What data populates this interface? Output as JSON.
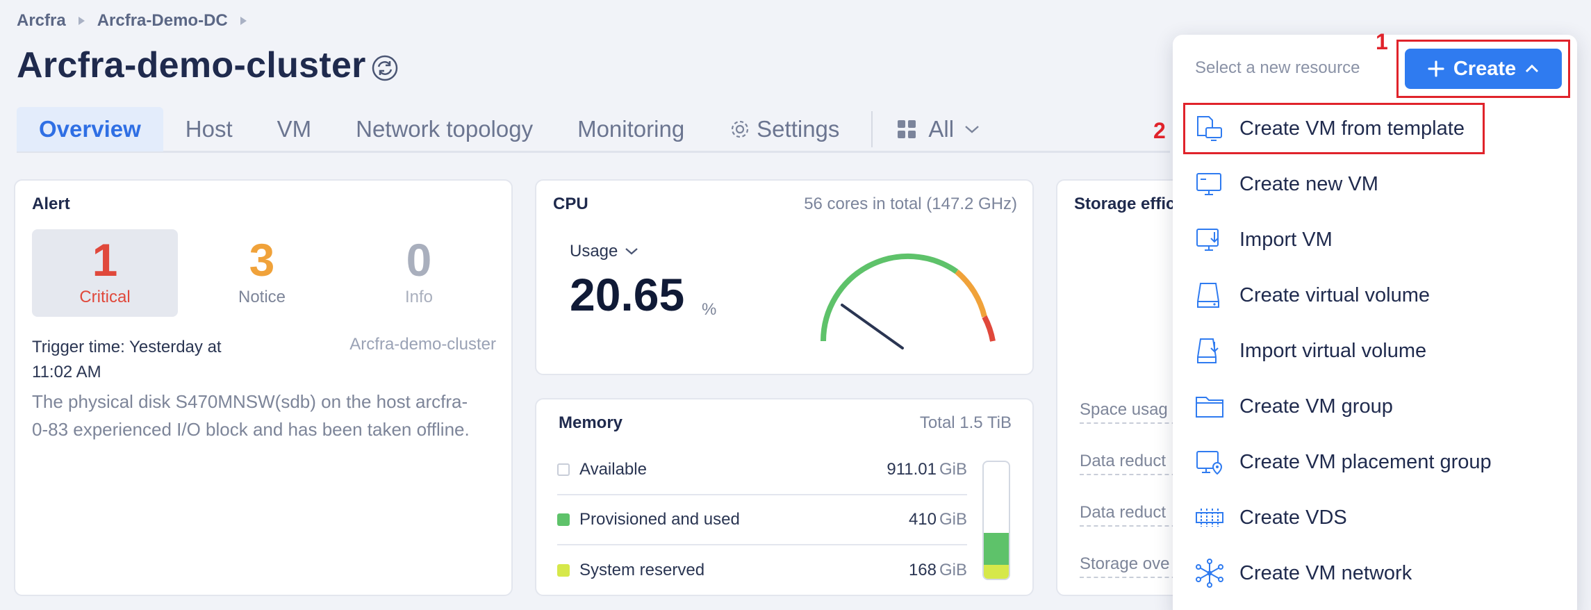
{
  "breadcrumb": [
    "Arcfra",
    "Arcfra-Demo-DC"
  ],
  "page_title": "Arcfra-demo-cluster",
  "tabs": {
    "overview": "Overview",
    "host": "Host",
    "vm": "VM",
    "network_topology": "Network topology",
    "monitoring": "Monitoring",
    "settings": "Settings",
    "all": "All"
  },
  "alert": {
    "title": "Alert",
    "critical": {
      "count": "1",
      "label": "Critical",
      "color": "#e0483b"
    },
    "notice": {
      "count": "3",
      "label": "Notice",
      "color": "#f0a23a"
    },
    "info": {
      "count": "0",
      "label": "Info",
      "color": "#a9afbd"
    },
    "trigger_time": "Trigger time: Yesterday at 11:02 AM",
    "cluster": "Arcfra-demo-cluster",
    "description": "The physical disk S470MNSW(sdb) on the host arcfra-0-83 experienced I/O block and has been taken offline."
  },
  "cpu": {
    "title": "CPU",
    "total": "56 cores in total (147.2 GHz)",
    "usage_label": "Usage",
    "usage_value": "20.65",
    "usage_unit": "%",
    "usage_fraction": 0.2065
  },
  "memory": {
    "title": "Memory",
    "total": "Total 1.5 TiB",
    "rows": [
      {
        "label": "Available",
        "value": "911.01",
        "unit": "GiB",
        "color": "#ffffff"
      },
      {
        "label": "Provisioned and used",
        "value": "410",
        "unit": "GiB",
        "color": "#5ec26a"
      },
      {
        "label": "System reserved",
        "value": "168",
        "unit": "GiB",
        "color": "#d6e84a"
      }
    ]
  },
  "storage": {
    "title": "Storage effici",
    "rows": [
      "Space usag",
      "Data reduct",
      "Data reduct",
      "Storage ove"
    ]
  },
  "dropdown": {
    "header": "Select a new resource",
    "create_label": "Create",
    "step1": "1",
    "step2": "2",
    "items": [
      {
        "label": "Create VM from template",
        "icon": "vm-template-icon"
      },
      {
        "label": "Create new VM",
        "icon": "monitor-icon"
      },
      {
        "label": "Import VM",
        "icon": "import-vm-icon"
      },
      {
        "label": "Create virtual volume",
        "icon": "volume-icon"
      },
      {
        "label": "Import virtual volume",
        "icon": "import-volume-icon"
      },
      {
        "label": "Create VM group",
        "icon": "folder-icon"
      },
      {
        "label": "Create VM placement group",
        "icon": "placement-group-icon"
      },
      {
        "label": "Create VDS",
        "icon": "vds-icon"
      },
      {
        "label": "Create VM network",
        "icon": "network-icon"
      }
    ]
  },
  "colors": {
    "accent": "#2f7bf0",
    "highlight": "#e0232b"
  }
}
